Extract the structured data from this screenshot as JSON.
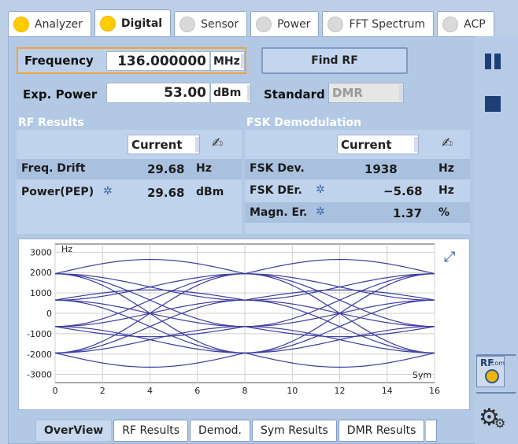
{
  "top_tabs": [
    {
      "label": "Analyzer",
      "active": false,
      "on": true
    },
    {
      "label": "Digital",
      "active": true,
      "on": true
    },
    {
      "label": "Sensor",
      "active": false,
      "on": false
    },
    {
      "label": "Power",
      "active": false,
      "on": false
    },
    {
      "label": "FFT Spectrum",
      "active": false,
      "on": false
    },
    {
      "label": "ACP",
      "active": false,
      "on": false
    }
  ],
  "freq": {
    "label": "Frequency",
    "value": "136.000000",
    "unit": "MHz"
  },
  "find_rf": "Find RF",
  "exp_power": {
    "label": "Exp. Power",
    "value": "53.00",
    "unit": "dBm"
  },
  "standard": {
    "label": "Standard",
    "value": "DMR"
  },
  "rf_results": {
    "title": "RF Results",
    "mode": "Current",
    "rows": [
      {
        "label": "Freq. Drift",
        "value": "29.68",
        "unit": "Hz"
      },
      {
        "label": "Power(PEP)",
        "value": "29.68",
        "unit": "dBm"
      }
    ]
  },
  "fsk": {
    "title": "FSK Demodulation",
    "mode": "Current",
    "rows": [
      {
        "label": "FSK Dev.",
        "value": "1938",
        "unit": "Hz"
      },
      {
        "label": "FSK DEr.",
        "value": "−5.68",
        "unit": "Hz"
      },
      {
        "label": "Magn. Er.",
        "value": "1.37",
        "unit": "%"
      }
    ]
  },
  "chart_data": {
    "type": "line",
    "title": "",
    "xlabel": "Sym",
    "ylabel": "Hz",
    "x_ticks": [
      0,
      2,
      4,
      6,
      8,
      10,
      12,
      14,
      16
    ],
    "y_ticks": [
      3000,
      2000,
      1000,
      0,
      -1000,
      -2000,
      -3000
    ],
    "xlim": [
      0,
      16
    ],
    "ylim": [
      -3400,
      3400
    ],
    "grid": true,
    "series_color": "#3c3ca0"
  },
  "bottom_tabs": [
    "OverView",
    "RF Results",
    "Demod.",
    "Sym Results",
    "DMR Results"
  ],
  "colors": {
    "accent": "#f0a43c",
    "panel": "#b3c8e4",
    "trace": "#3c3ca0"
  }
}
